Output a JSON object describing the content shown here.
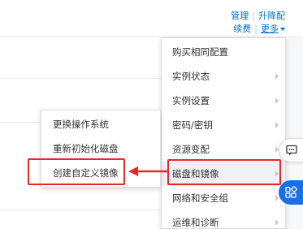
{
  "top_actions": {
    "manage": "管理",
    "upgrade": "升降配",
    "renew": "续费",
    "more": "更多"
  },
  "main_menu": {
    "items": [
      {
        "label": "购买相同配置",
        "has_submenu": false
      },
      {
        "label": "实例状态",
        "has_submenu": true
      },
      {
        "label": "实例设置",
        "has_submenu": true
      },
      {
        "label": "密码/密钥",
        "has_submenu": true
      },
      {
        "label": "资源变配",
        "has_submenu": true
      },
      {
        "label": "磁盘和镜像",
        "has_submenu": true,
        "active": true
      },
      {
        "label": "网络和安全组",
        "has_submenu": true
      },
      {
        "label": "运维和诊断",
        "has_submenu": true
      }
    ]
  },
  "sub_menu": {
    "items": [
      {
        "label": "更换操作系统"
      },
      {
        "label": "重新初始化磁盘"
      },
      {
        "label": "创建自定义镜像",
        "highlighted": true
      }
    ]
  },
  "colors": {
    "link": "#0070cc",
    "annotation_red": "#e22a2a",
    "active_bg": "#eef1f6",
    "float_blue": "#1a6ee8"
  },
  "icons": {
    "chat": "chat-bubble-icon",
    "apps": "apps-grid-icon"
  }
}
